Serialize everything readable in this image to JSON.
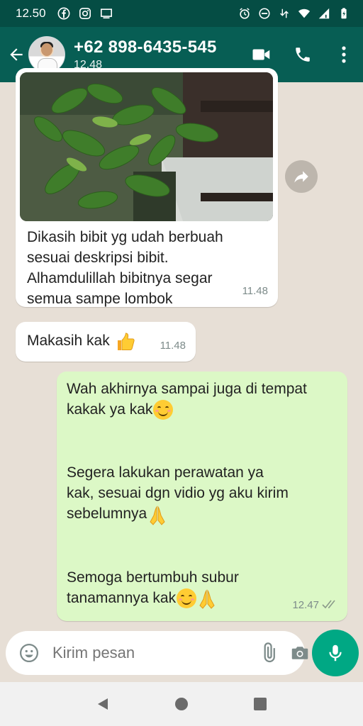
{
  "status_bar": {
    "time": "12.50",
    "icons": [
      "facebook-icon",
      "instagram-icon",
      "cast-icon",
      "alarm-icon",
      "dnd-icon",
      "data-arrows-icon",
      "wifi-icon",
      "signal-icon",
      "battery-icon"
    ]
  },
  "header": {
    "contact_name": "+62 898-6435-545",
    "last_seen": "12.48",
    "icons": [
      "back-arrow-icon",
      "video-call-icon",
      "phone-icon",
      "more-vert-icon"
    ]
  },
  "messages": [
    {
      "direction": "incoming",
      "has_image": true,
      "text": "Dikasih bibit yg udah berbuah\nsesuai deskripsi bibit.\nAlhamdulillah bibitnya segar\nsemua sampe lombok",
      "time": "11.48"
    },
    {
      "direction": "incoming",
      "text": "Makasih kak",
      "emoji": "thumbs-up",
      "time": "11.48"
    },
    {
      "direction": "outgoing",
      "paragraphs": [
        "Wah akhirnya sampai juga di tempat\nkakak ya kak",
        "Segera lakukan perawatan ya\nkak, sesuai dgn vidio yg aku kirim\nsebelumnya",
        "Semoga bertumbuh subur\ntanamannya kak"
      ],
      "time": "12.47",
      "status": "read"
    }
  ],
  "input": {
    "placeholder": "Kirim pesan"
  },
  "colors": {
    "header": "#075e54",
    "status_bar": "#054d44",
    "outgoing_bubble": "#dcf8c6",
    "incoming_bubble": "#ffffff",
    "mic_button": "#00a884",
    "chat_bg": "#e7dfd6"
  }
}
